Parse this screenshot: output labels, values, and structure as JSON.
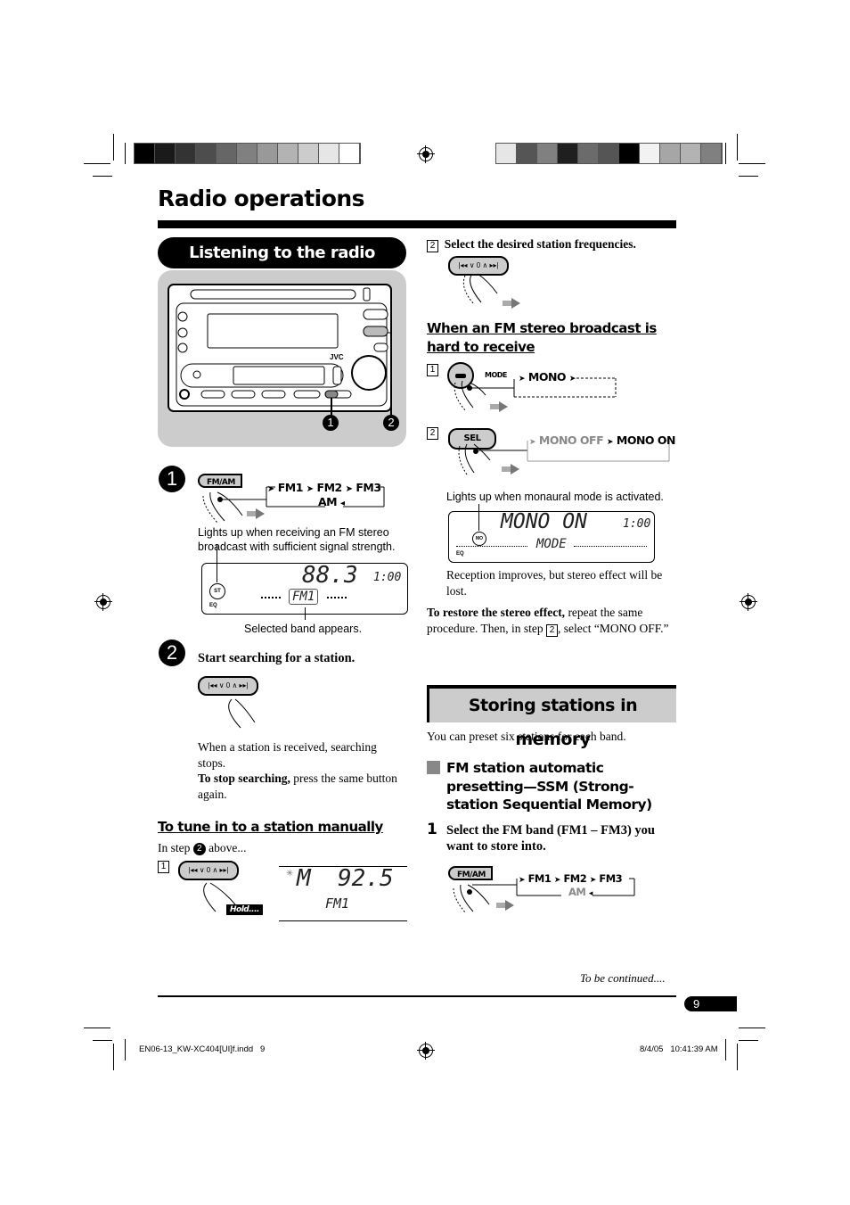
{
  "page": {
    "title": "Radio operations",
    "page_number": "9",
    "continued": "To be continued....",
    "footer_file": "EN06-13_KW-XC404[UI]f.indd   9",
    "footer_date": "8/4/05   10:41:39 AM"
  },
  "left_column": {
    "section_title": "Listening to the radio",
    "device_callouts": [
      "1",
      "2"
    ],
    "device_brand": "JVC",
    "step1": {
      "number": "1",
      "button": "FM/AM",
      "bands": [
        "FM1",
        "FM2",
        "FM3",
        "AM"
      ],
      "st_caption": "Lights up when receiving an FM stereo broadcast with sufficient signal strength.",
      "display_frequency": "88.3",
      "display_clock": "1:00",
      "display_band": "FM1",
      "st_label": "ST",
      "eq_label": "EQ",
      "band_caption": "Selected band appears."
    },
    "step2": {
      "number": "2",
      "heading": "Start searching for a station.",
      "seek_button": "|◂◂ ∨ 0 ∧ ▸▸|",
      "text1": "When a station is received, searching stops.",
      "stop_bold": "To stop searching,",
      "stop_text": " press the same button again."
    },
    "manual": {
      "heading": "To tune in to a station manually",
      "intro_pre": "In step ",
      "intro_step": "2",
      "intro_post": " above...",
      "substep": "1",
      "hold_label": "Hold....",
      "display_mode": "M",
      "display_frequency": "92.5",
      "display_band": "FM1"
    }
  },
  "right_column": {
    "substep2": {
      "number": "2",
      "text": "Select the desired station frequencies."
    },
    "fm_stereo": {
      "heading": "When an FM stereo broadcast is hard to receive",
      "step1_number": "1",
      "mode_label": "MODE",
      "mono_label": "MONO",
      "step2_number": "2",
      "sel_button": "SEL",
      "mono_off": "MONO OFF",
      "mono_on": "MONO ON",
      "mo_caption": "Lights up when monaural mode is activated.",
      "display_main": "MONO ON",
      "display_clock": "1:00",
      "display_sub": "MODE",
      "mo_label": "MO",
      "eq_label": "EQ",
      "result": "Reception improves, but stereo effect will be lost.",
      "restore_bold": "To restore the stereo effect,",
      "restore_text1": " repeat the same procedure. Then, in step ",
      "restore_step": "2",
      "restore_text2": ", select “MONO OFF.”"
    },
    "storing": {
      "section_title": "Storing stations in memory",
      "intro": "You can preset six stations for each band.",
      "ssm_heading": "FM station automatic presetting—SSM (Strong-station Sequential Memory)",
      "step1_number": "1",
      "step1_text": "Select the FM band (FM1 – FM3) you want to store into.",
      "button": "FM/AM",
      "bands": [
        "FM1",
        "FM2",
        "FM3",
        "AM"
      ]
    }
  },
  "colors": {
    "grey_box": "#cccccc",
    "dim_text": "#888888",
    "left_color_bar": [
      "#000000",
      "#1a1a1a",
      "#333333",
      "#4d4d4d",
      "#666666",
      "#808080",
      "#999999",
      "#b3b3b3",
      "#cccccc",
      "#e6e6e6",
      "#ffffff"
    ],
    "right_color_bar": [
      "#e6e6e6",
      "#555555",
      "#808080",
      "#1f1f1f",
      "#6b6b6b",
      "#555555",
      "#000000",
      "#f2f2f2",
      "#a6a6a6",
      "#b3b3b3",
      "#808080"
    ]
  }
}
